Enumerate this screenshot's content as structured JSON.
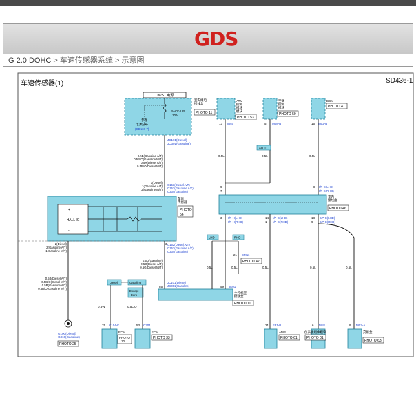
{
  "header": {
    "logo_main": "GD",
    "logo_accent": "S",
    "breadcrumb": [
      "G 2.0 DOHC",
      "车速传感器系统",
      "示意图"
    ],
    "separator": ">"
  },
  "diagram": {
    "title": "车速传感器(1)",
    "code": "SD436-1",
    "on_st": "ON/ST 电源",
    "fuse_box": [
      "室内继电",
      "接线盒"
    ],
    "backup_label": "BACK-UP",
    "backup_amp": "10A",
    "ref_label": [
      "参考",
      "电源分布"
    ],
    "ref_link": "(SD110-7)",
    "photo_11": "PHOTO 11",
    "jc101_diesel": "JC101(Diesel)",
    "jc301_gas": "JC301(Gasoline)",
    "atm": [
      "ATM",
      "控制",
      "模块",
      "模块"
    ],
    "atm_photo": "PHOTO 53",
    "ac": [
      "空调",
      "控制",
      "模块"
    ],
    "ac_photo": "PHOTO 59",
    "bcm": "BCM",
    "bcm_photo": "PHOTO 47",
    "pin_13": "13",
    "m45": "M45",
    "pin_5": "5",
    "m08b": "M08-B",
    "pin_15": "15",
    "m02b": "M02-B",
    "auto": "AUTO",
    "wire_05l": "0.5L",
    "wires_upper": [
      "0.5B(Gasoline A/T)",
      "0.5B/O(Gasoline M/T)",
      "0.5R(Diesel A/T)",
      "0.5R/O(Diesel M/T)"
    ],
    "conn_top": [
      "1(Diesel)",
      "1(Gasoline A/T)",
      "2(Gasoline M/T)"
    ],
    "conn_top_codes": [
      "C153(Diesel A/T)",
      "C153(Gasoline A/T)",
      "C334(Gasoline)"
    ],
    "sensor_name": [
      "车速",
      "传感器"
    ],
    "sensor_photo": [
      "PHOTO",
      "56"
    ],
    "hall_ic": "HALL IC",
    "plus": "+",
    "minus": "-",
    "conn_bot_l": [
      "2(Diesel)",
      "2(Gasoline A/T)",
      "1(Gasoline M/T)"
    ],
    "conn_bot_r": [
      "C152(Diesel A/T)",
      "C153(Gasoline A/T)",
      "C334(Gasoline)"
    ],
    "pin_3": "3",
    "wires_mid": [
      "0.5O(Gasoline)",
      "0.5G(Diesel A/T)",
      "0.5G(Diesel M/T)"
    ],
    "wires_left": [
      "0.5B(Diesel A/T)",
      "0.5B/O(Diesel M/T)",
      "0.5B(Gasoline A/T)",
      "0.5B/O(Gasoline M/T)"
    ],
    "diesel_tag": "Diesel",
    "gasoline_tag": "Gasoline",
    "except_euro": [
      "Except",
      "Euro"
    ],
    "jc101": "JC101(Diesel)",
    "jc301": "JC301(Gasoline)",
    "jc_pin85": "85",
    "jc_pin59": "59",
    "je01": "JE01",
    "jc_name": [
      "主控机室",
      "接线盒"
    ],
    "lhd": "LHD",
    "rhd": "RHD",
    "em11": "EM11",
    "pin_21": "21",
    "photo_42": "PHOTO 42",
    "wire_05sw": "0.5W",
    "wire_05lo": "0.5L/O",
    "pin_9": "9",
    "pin_7": "7",
    "pin_8": "8",
    "ip_c_lhd": "I/P-C(LHD)",
    "ip_e_rhd": "I/P-E(RHD)",
    "junction_name": [
      "室内",
      "接线盒"
    ],
    "photo_46": "PHOTO 46",
    "pin_3b": "3",
    "pin_14": "14",
    "pin_1": "1",
    "pin_18": "18",
    "pin_9b": "9",
    "ip_h_lhd": "I/P-H(LHD)",
    "ip_hr_rhd": "I/P-H(RHD)",
    "ip_g_lhd": "I/P-G(LHD)",
    "ip_gr_rhd": "I/P-G(RHD)",
    "ip_c_lhd2": "I/P-C(LHD)",
    "ip_cr_rhd": "I/P-C(RHD)",
    "g100": "G100(Diesel)",
    "g310": "G310(Gasoline)",
    "photo_25": "PHOTO 25",
    "c104k": "C104-K",
    "ecm": "ECM",
    "photo_10": [
      "PHOTO",
      "10"
    ],
    "c301": "C301",
    "photo_33": "PHOTO 33",
    "pin_75": "75",
    "pin_53": "53",
    "f31b": "F31-B",
    "amp": "AMP",
    "photo_61": "PHOTO 61",
    "m18": "M18",
    "cluster": "仪表板组件模块",
    "photo_01": "PHOTO 01",
    "m03a": "M03-A",
    "seat": "交易盒",
    "photo_63": "PHOTO 63",
    "pin_6": "6",
    "pin_9c": "9"
  }
}
